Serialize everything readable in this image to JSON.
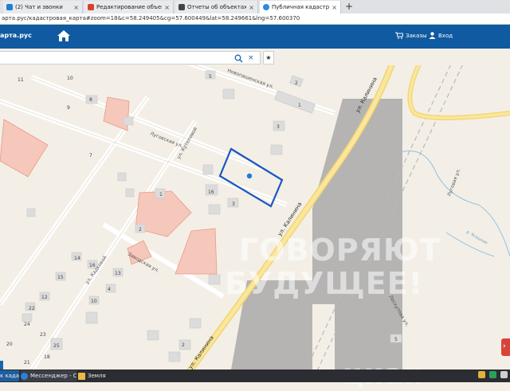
{
  "browser": {
    "tabs": [
      {
        "label": "(2) Чат и звонки",
        "color": "#1d7ed6",
        "close": "×",
        "active": false
      },
      {
        "label": "Редактирование объекта Л",
        "color": "#d8402f",
        "close": "×",
        "active": false
      },
      {
        "label": "Отчеты об объектах недви",
        "color": "#444444",
        "close": "×",
        "active": false
      },
      {
        "label": "Публичная кадастровая ка",
        "color": "#2a8ddb",
        "close": "×",
        "active": true
      }
    ],
    "new_tab": "+",
    "url": "арта.рус/кадастровая_карта#zoom=18&c=58.249405&cg=57.600449&lat=58.249661&lng=57.600370"
  },
  "site": {
    "name": "арта.рус",
    "orders_label": "Заказы",
    "login_label": "Вход",
    "brand_color": "#0f5aa0"
  },
  "search": {
    "value": "",
    "placeholder": "",
    "clear": "×",
    "fav": "★"
  },
  "map": {
    "streets": [
      {
        "name": "Новопашенская ул."
      },
      {
        "name": "Луговская ул."
      },
      {
        "name": "ул. Кутеповой"
      },
      {
        "name": "ул. Кадковой"
      },
      {
        "name": "Заводская ул."
      },
      {
        "name": "ул. Калинина"
      },
      {
        "name": "ул. Калинина"
      },
      {
        "name": "ул. Калинина"
      },
      {
        "name": "Луговая ул."
      },
      {
        "name": "Лоскутова ул."
      },
      {
        "name": "р. Ясашная"
      }
    ],
    "house_numbers": [
      "11",
      "10",
      "9",
      "8",
      "5",
      "2",
      "1",
      "3",
      "7",
      "16",
      "1",
      "3",
      "2",
      "14",
      "16",
      "15",
      "13",
      "12",
      "10",
      "4",
      "22",
      "24",
      "23",
      "25",
      "20",
      "18",
      "21",
      "2",
      "5"
    ],
    "watermark": [
      "ГОВОРЯЮТ",
      "БУДУЩЕЕ!",
      "циан"
    ],
    "red_button": "›"
  },
  "taskbar": {
    "items": [
      {
        "label": "к када...",
        "color": "#1d7ed6"
      },
      {
        "label": "Мессенджер - С...",
        "color": "#2f7fd8"
      },
      {
        "label": "Земля",
        "color": "#e9b94a"
      }
    ]
  }
}
